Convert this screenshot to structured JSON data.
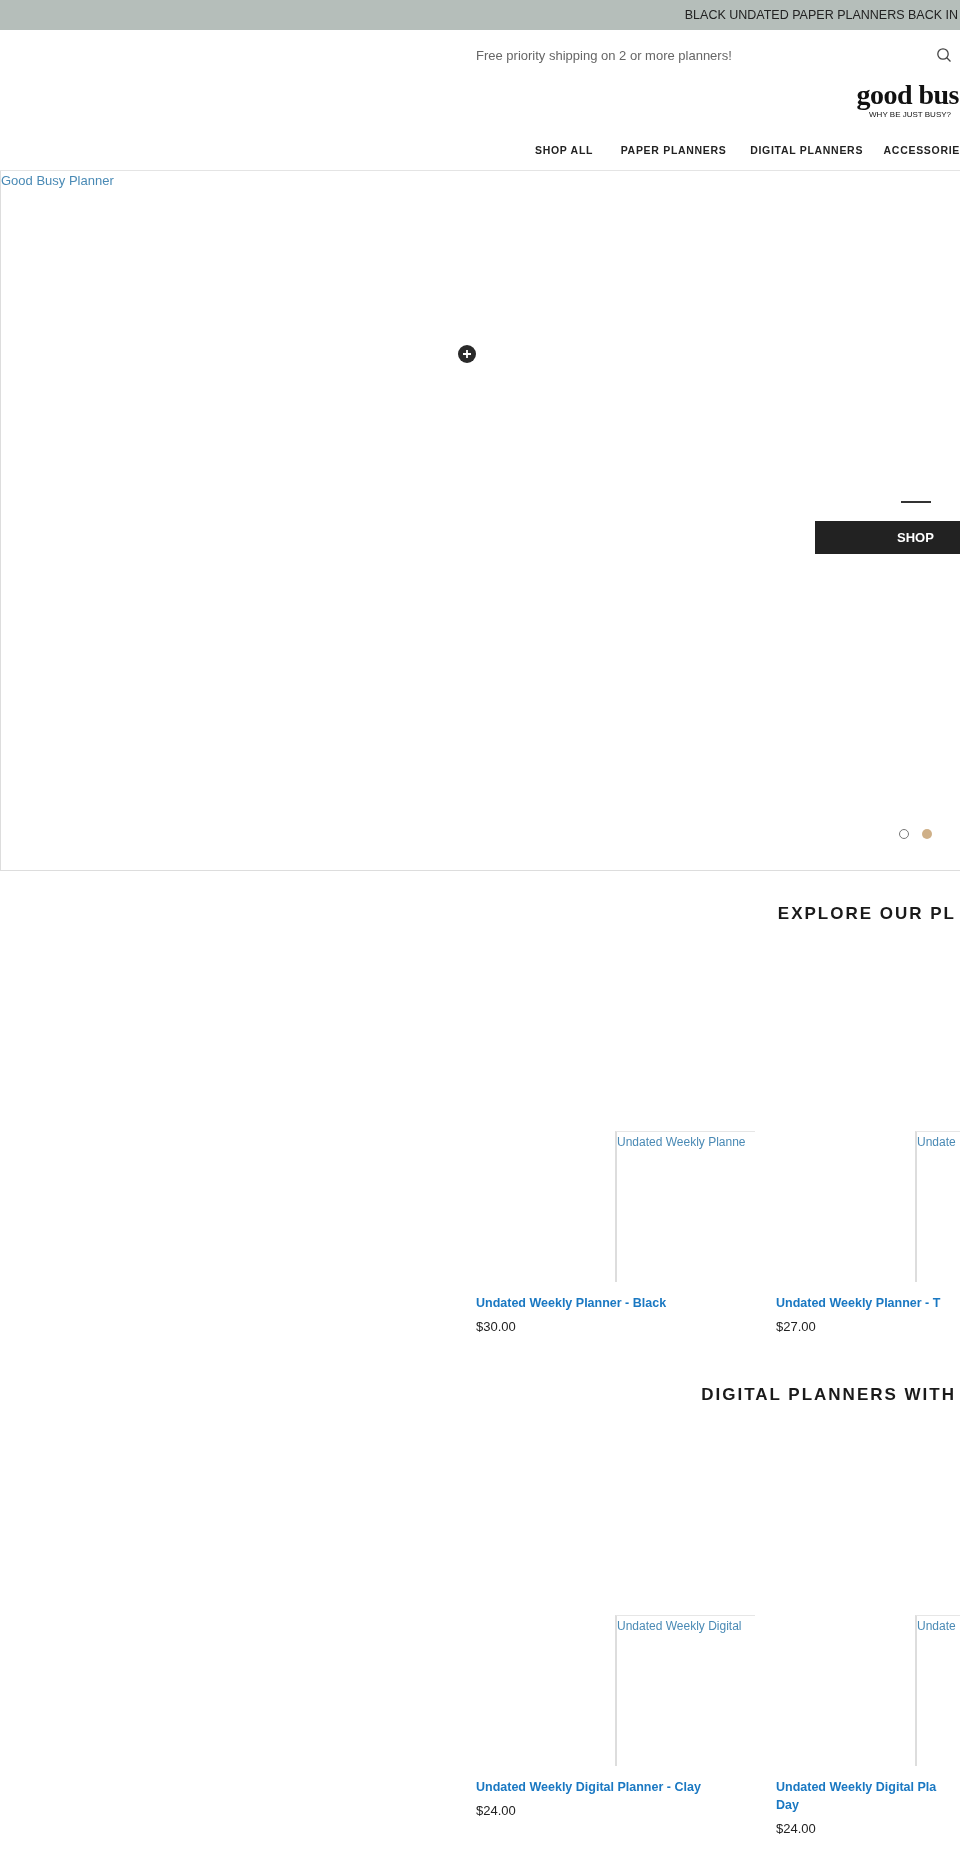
{
  "announcement": "BLACK UNDATED PAPER PLANNERS BACK IN",
  "header": {
    "shipping_note": "Free priority shipping on 2 or more planners!",
    "logo": {
      "wordmark": "good bus",
      "tagline": "WHY BE JUST BUSY?"
    },
    "nav": [
      "SHOP ALL",
      "PAPER PLANNERS",
      "DIGITAL PLANNERS",
      "ACCESSORIE"
    ]
  },
  "hero": {
    "image_alt": "Good Busy Planner",
    "button": "SHOP",
    "slides": [
      {
        "selected": false
      },
      {
        "selected": true
      }
    ]
  },
  "sections": [
    {
      "heading": "EXPLORE OUR PL",
      "products": [
        {
          "image_alt": "Undated Weekly Planne",
          "title_lines": [
            "Undated Weekly Planner - Black"
          ],
          "price": "$30.00"
        },
        {
          "image_alt": "Undate",
          "title_lines": [
            "Undated Weekly Planner - T"
          ],
          "price": "$27.00"
        }
      ]
    },
    {
      "heading": "DIGITAL PLANNERS WITH",
      "products": [
        {
          "image_alt": "Undated Weekly Digital",
          "title_lines": [
            "Undated Weekly Digital Planner - Clay"
          ],
          "price": "$24.00"
        },
        {
          "image_alt": "Undate",
          "title_lines": [
            "Undated Weekly Digital Pla",
            "Day"
          ],
          "price": "$24.00"
        }
      ]
    }
  ]
}
